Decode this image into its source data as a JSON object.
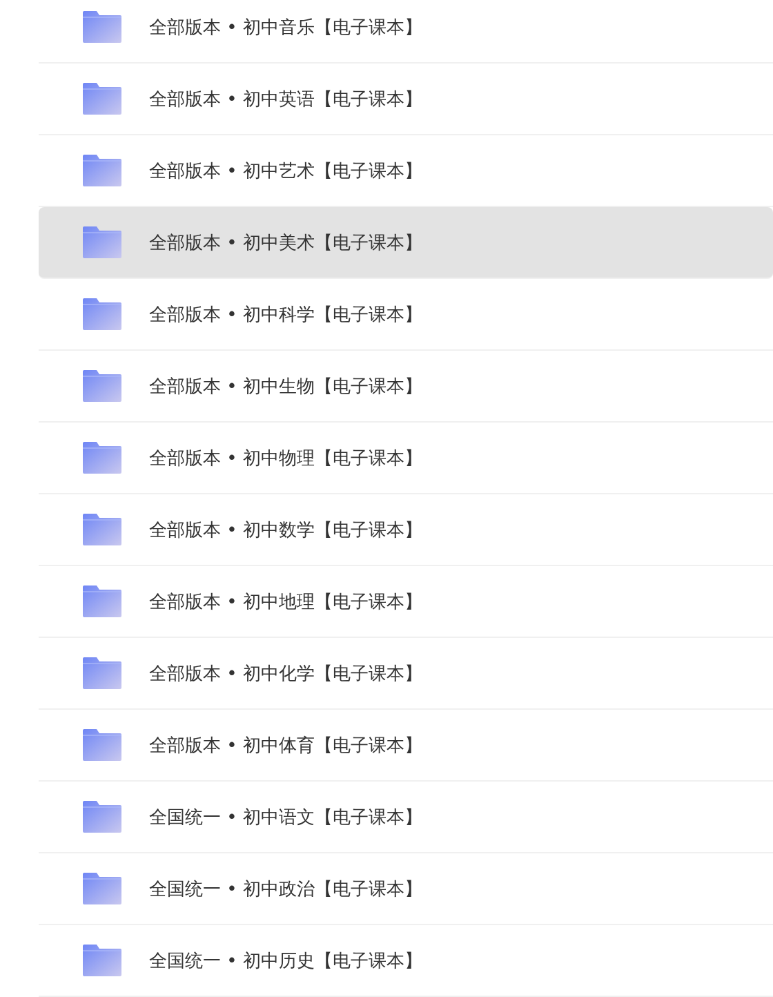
{
  "folders": [
    {
      "name": "全部版本 • 初中音乐【电子课本】",
      "selected": false
    },
    {
      "name": "全部版本 • 初中英语【电子课本】",
      "selected": false
    },
    {
      "name": "全部版本 • 初中艺术【电子课本】",
      "selected": false
    },
    {
      "name": "全部版本 • 初中美术【电子课本】",
      "selected": true
    },
    {
      "name": "全部版本 • 初中科学【电子课本】",
      "selected": false
    },
    {
      "name": "全部版本 • 初中生物【电子课本】",
      "selected": false
    },
    {
      "name": "全部版本 • 初中物理【电子课本】",
      "selected": false
    },
    {
      "name": "全部版本 • 初中数学【电子课本】",
      "selected": false
    },
    {
      "name": "全部版本 • 初中地理【电子课本】",
      "selected": false
    },
    {
      "name": "全部版本 • 初中化学【电子课本】",
      "selected": false
    },
    {
      "name": "全部版本 • 初中体育【电子课本】",
      "selected": false
    },
    {
      "name": "全国统一 • 初中语文【电子课本】",
      "selected": false
    },
    {
      "name": "全国统一 • 初中政治【电子课本】",
      "selected": false
    },
    {
      "name": "全国统一 • 初中历史【电子课本】",
      "selected": false
    }
  ]
}
